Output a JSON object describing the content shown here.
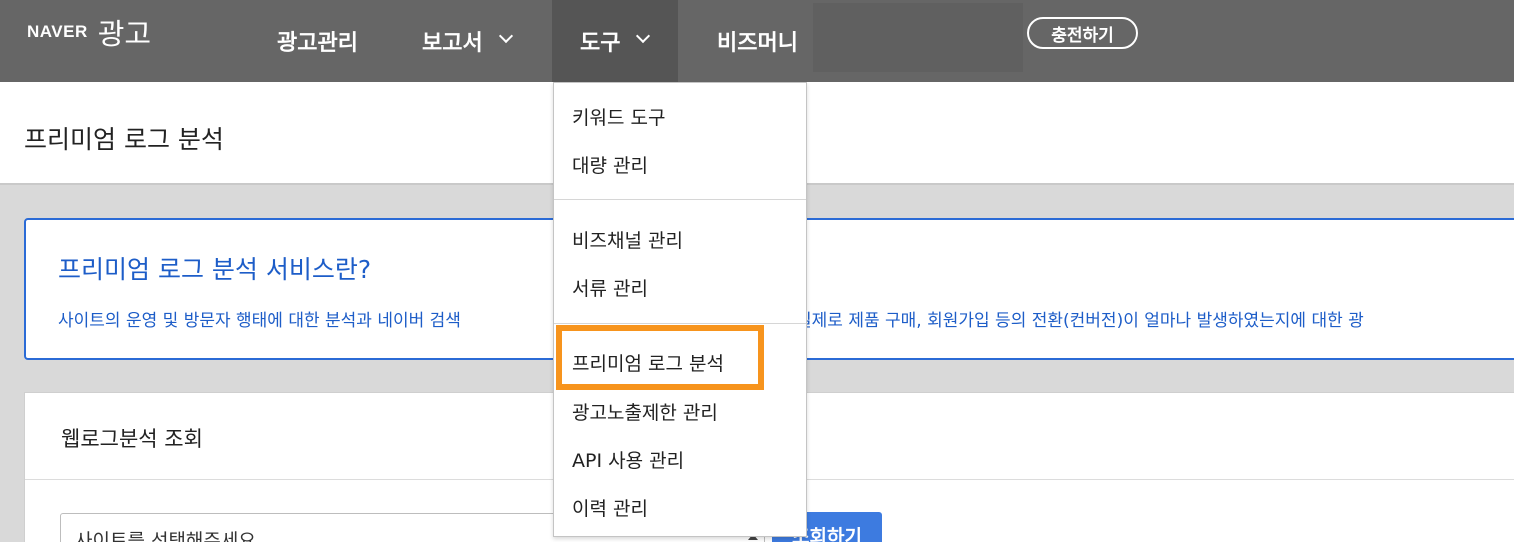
{
  "header": {
    "brand": "NAVER",
    "service": "광고",
    "nav": {
      "ad_management": "광고관리",
      "reports": "보고서",
      "tools": "도구",
      "bizmoney": "비즈머니"
    },
    "charge_button": "충전하기"
  },
  "page": {
    "title": "프리미엄 로그 분석"
  },
  "info": {
    "title": "프리미엄 로그 분석 서비스란?",
    "description_left": "사이트의 운영 및 방문자 행태에 대한 분석과 네이버 검색",
    "description_right": "실제로 제품 구매, 회원가입 등의 전환(컨버전)이 얼마나 발생하였는지에 대한 광"
  },
  "panel": {
    "title": "웹로그분석 조회",
    "select_placeholder": "사이트를 선택해주세요",
    "search_button": "조회하기"
  },
  "dropdown": {
    "items": [
      "키워드 도구",
      "대량 관리",
      "비즈채널 관리",
      "서류 관리",
      "프리미엄 로그 분석",
      "광고노출제한 관리",
      "API 사용 관리",
      "이력 관리"
    ]
  },
  "colors": {
    "topbar": "#666666",
    "accent_blue": "#2b6bd6",
    "highlight_orange": "#f7941d"
  }
}
